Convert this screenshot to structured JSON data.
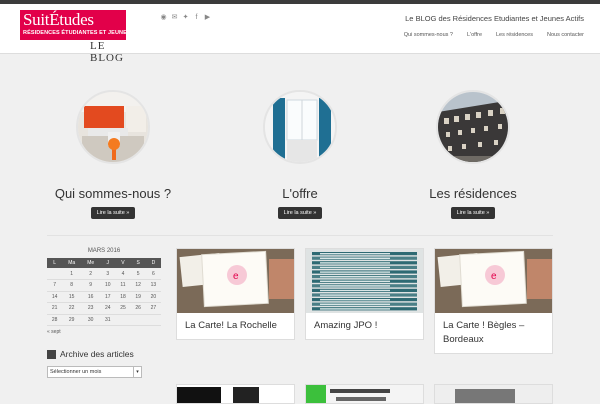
{
  "brand": {
    "name_main": "SuitÉtudes",
    "name_sub": "RÉSIDENCES ÉTUDIANTES ET JEUNES ACTIFS",
    "blog_label": "LE BLOG"
  },
  "header": {
    "tagline": "Le BLOG des Résidences Etudiantes et Jeunes Actifs"
  },
  "social_icons": [
    "rss-icon",
    "mail-icon",
    "twitter-icon",
    "facebook-icon",
    "youtube-icon"
  ],
  "nav": {
    "items": [
      "Qui sommes-nous ?",
      "L'offre",
      "Les résidences",
      "Nous contacter"
    ]
  },
  "features": [
    {
      "title": "Qui sommes-nous ?",
      "button": "Lire la suite »"
    },
    {
      "title": "L'offre",
      "button": "Lire la suite »"
    },
    {
      "title": "Les résidences",
      "button": "Lire la suite »"
    }
  ],
  "calendar": {
    "caption": "MARS 2016",
    "days": [
      "L",
      "Ma",
      "Me",
      "J",
      "V",
      "S",
      "D"
    ],
    "weeks": [
      [
        "",
        "1",
        "2",
        "3",
        "4",
        "5",
        "6"
      ],
      [
        "7",
        "8",
        "9",
        "10",
        "11",
        "12",
        "13"
      ],
      [
        "14",
        "15",
        "16",
        "17",
        "18",
        "19",
        "20"
      ],
      [
        "21",
        "22",
        "23",
        "24",
        "25",
        "26",
        "27"
      ],
      [
        "28",
        "29",
        "30",
        "31",
        "",
        "",
        ""
      ]
    ],
    "prev": "« sept"
  },
  "archive": {
    "title": "Archive des articles",
    "select_placeholder": "Sélectionner un mois"
  },
  "posts": [
    {
      "title": "La Carte! La Rochelle"
    },
    {
      "title": "Amazing JPO !"
    },
    {
      "title": "La Carte ! Bègles – Bordeaux"
    }
  ],
  "colors": {
    "brand": "#e2004a",
    "dark": "#333333",
    "bg": "#f0f0f0"
  }
}
